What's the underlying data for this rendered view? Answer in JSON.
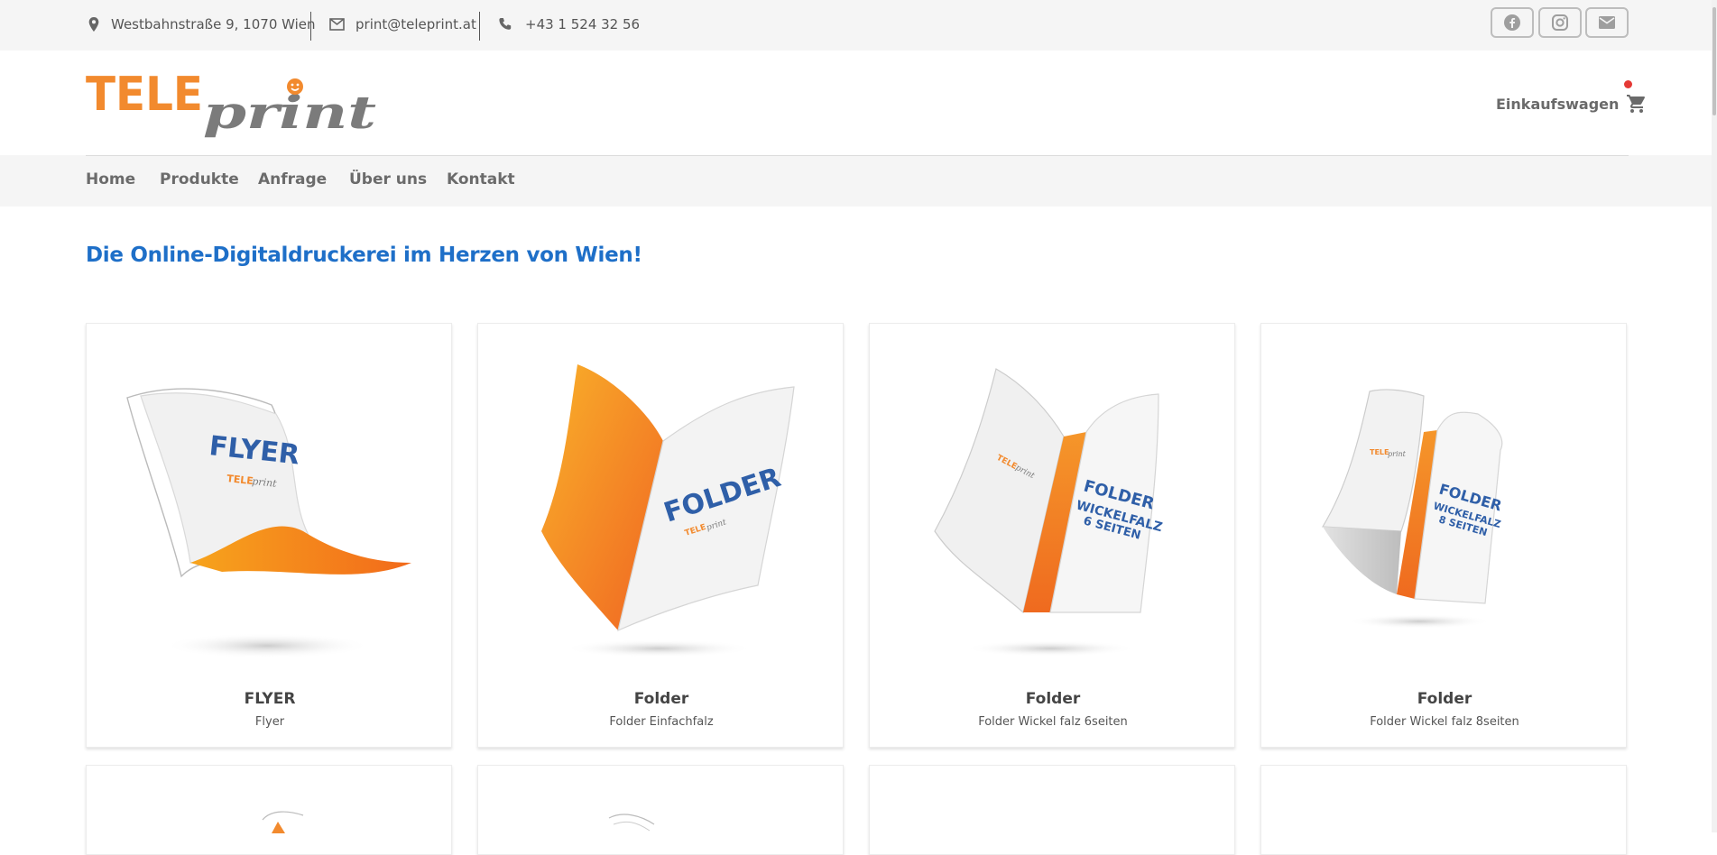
{
  "topbar": {
    "address": "Westbahnstraße 9, 1070 Wien",
    "email": "print@teleprint.at",
    "phone": "+43 1 524 32 56",
    "social": [
      "facebook-icon",
      "instagram-icon",
      "mail-icon"
    ]
  },
  "logo": {
    "part1": "TELE",
    "part2": "print"
  },
  "cart": {
    "label": "Einkaufswagen"
  },
  "nav": {
    "items": [
      "Home",
      "Produkte",
      "Anfrage",
      "Über uns",
      "Kontakt"
    ]
  },
  "headline": "Die Online-Digitaldruckerei im Herzen von Wien!",
  "products": [
    {
      "title": "FLYER",
      "subtitle": "Flyer",
      "art_text": [
        "FLYER"
      ]
    },
    {
      "title": "Folder",
      "subtitle": "Folder Einfachfalz",
      "art_text": [
        "FOLDER"
      ]
    },
    {
      "title": "Folder",
      "subtitle": "Folder Wickel falz 6seiten",
      "art_text": [
        "FOLDER",
        "WICKELFALZ",
        "6 SEITEN"
      ]
    },
    {
      "title": "Folder",
      "subtitle": "Folder Wickel falz 8seiten",
      "art_text": [
        "FOLDER",
        "WICKELFALZ",
        "8 SEITEN"
      ]
    }
  ],
  "colors": {
    "brand_orange": "#f28a2e",
    "brand_gray": "#7b7b7b",
    "heading_blue": "#1e6fc8",
    "art_blue": "#2f5fa8"
  }
}
